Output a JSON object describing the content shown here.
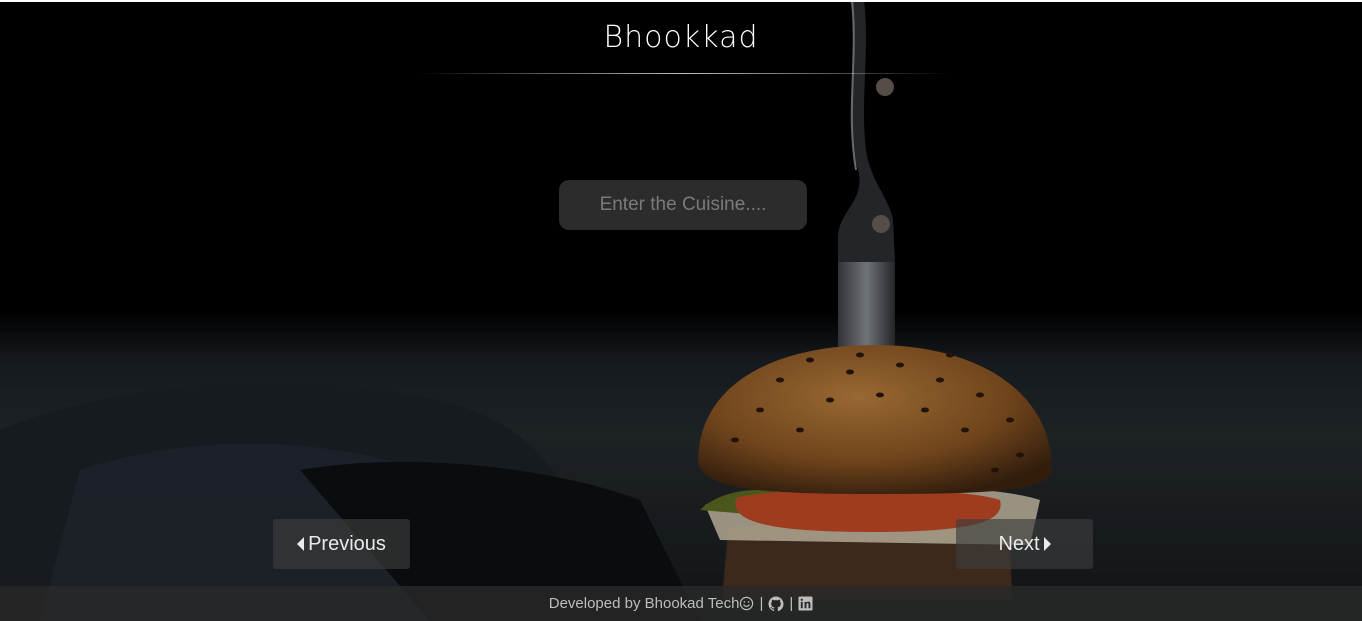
{
  "app": {
    "title": "Bhookkad"
  },
  "search": {
    "placeholder": "Enter the Cuisine...."
  },
  "navigation": {
    "previous_label": "Previous",
    "next_label": "Next"
  },
  "footer": {
    "developed_by": "Developed by Bhookad Tech",
    "separator": "|",
    "icons": [
      "smiley-icon",
      "github-icon",
      "linkedin-icon"
    ]
  },
  "colors": {
    "background": "#000000",
    "title_text": "#ffffff",
    "footer_bg": "#282828",
    "footer_text": "#bdbdbd"
  }
}
